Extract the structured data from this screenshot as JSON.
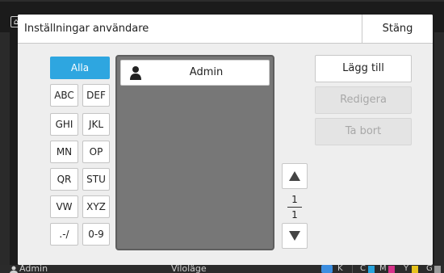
{
  "dialog": {
    "title": "Inställningar användare",
    "close_label": "Stäng"
  },
  "filter": {
    "buttons": [
      {
        "label": "Alla",
        "active": true
      },
      {
        "label": "ABC"
      },
      {
        "label": "DEF"
      },
      {
        "label": "GHI"
      },
      {
        "label": "JKL"
      },
      {
        "label": "MN"
      },
      {
        "label": "OP"
      },
      {
        "label": "QR"
      },
      {
        "label": "STU"
      },
      {
        "label": "VW"
      },
      {
        "label": "XYZ"
      },
      {
        "label": ".-/"
      },
      {
        "label": "0-9"
      }
    ]
  },
  "users": [
    {
      "name": "Admin",
      "icon": "user-icon"
    }
  ],
  "pager": {
    "current": "1",
    "total": "1",
    "up_icon": "triangle-up-icon",
    "down_icon": "triangle-down-icon"
  },
  "actions": {
    "add_label": "Lägg till",
    "edit_label": "Redigera",
    "delete_label": "Ta bort",
    "edit_enabled": false,
    "delete_enabled": false
  },
  "status_bar": {
    "user": "Admin",
    "mode": "Viloläge",
    "ink": {
      "k_label": "K",
      "c_label": "C",
      "m_label": "M",
      "y_label": "Y",
      "g_label": "G",
      "colors": {
        "c": "#29a3dc",
        "m": "#d6338a",
        "y": "#e6c21d"
      }
    }
  },
  "colors": {
    "accent": "#2ea6e0",
    "list_background": "#777777"
  }
}
